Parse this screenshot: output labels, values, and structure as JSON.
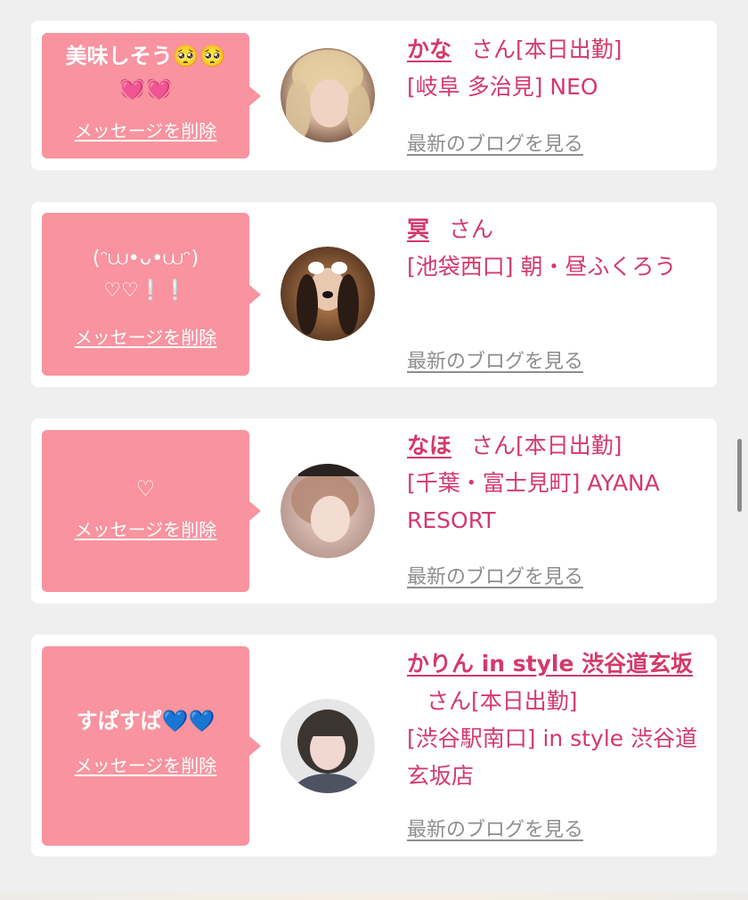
{
  "delete_label": "メッセージを削除",
  "blog_label": "最新のブログを見る",
  "san_label": "さん",
  "messages": [
    {
      "message": "美味しそう🥺🥺\n💓💓",
      "name": "かな",
      "attendance": "[本日出勤]",
      "shop": "[岐阜 多治見] NEO"
    },
    {
      "message": "(ᵔ⩊•ᴗ•⩊ᵔ)\n♡♡❕❕",
      "name": "冥",
      "attendance": "",
      "shop": "[池袋西口] 朝・昼ふくろう"
    },
    {
      "message": "♡",
      "name": "なほ",
      "attendance": "[本日出勤]",
      "shop": "[千葉・富士見町] AYANA RESORT"
    },
    {
      "message": "すぱすぱ💙💙",
      "name": "かりん in style 渋谷道玄坂",
      "attendance": "[本日出勤]",
      "shop": "[渋谷駅南口] in style 渋谷道玄坂店"
    }
  ],
  "colors": {
    "background": "#efefef",
    "bubble": "#f8939f",
    "accent": "#d4396a",
    "link_gray": "#8e8e8e"
  }
}
